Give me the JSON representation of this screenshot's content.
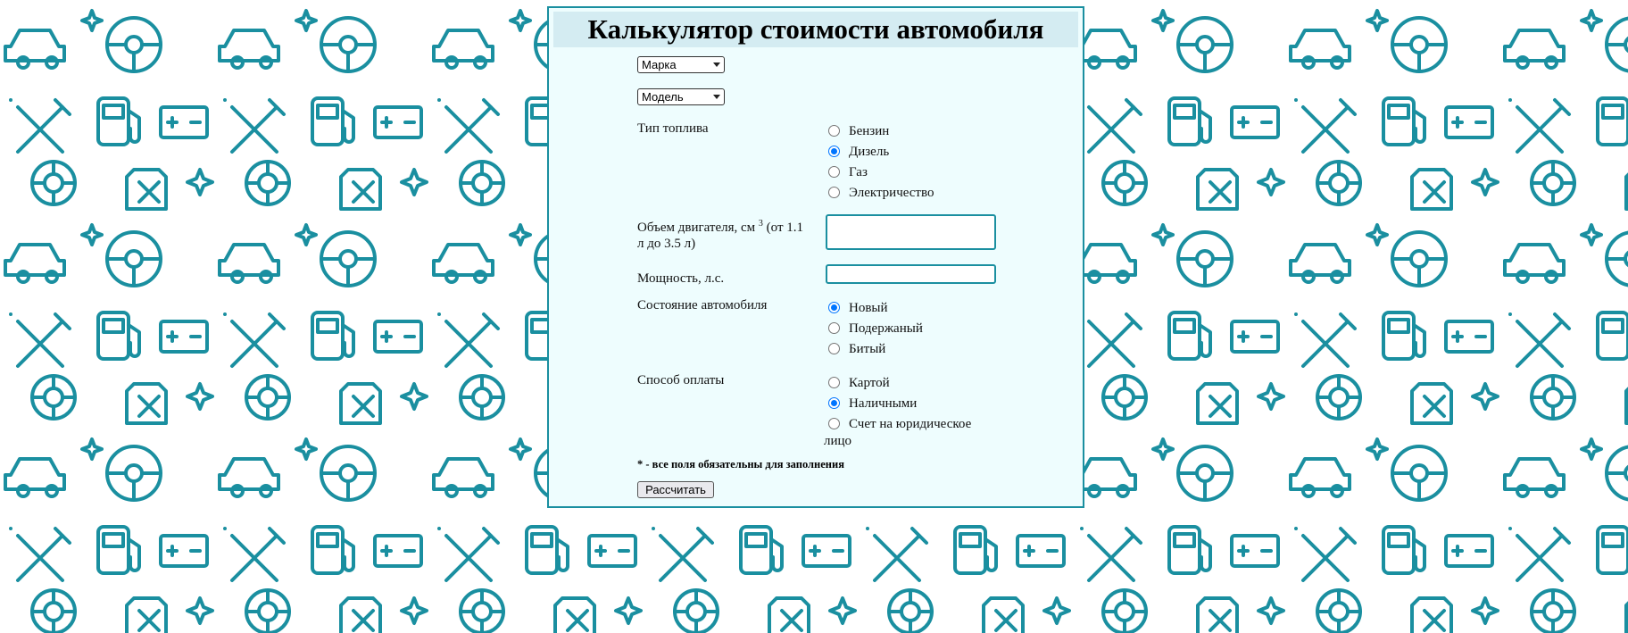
{
  "background": {
    "pattern_color": "#1a8fa0",
    "pattern": "automotive line icons"
  },
  "colors": {
    "accent": "#1a8fa0",
    "panel_bg": "#eefdfe",
    "title_bg": "#d4ecf2",
    "radio_checked": "#0075ff"
  },
  "title": "Калькулятор стоимости автомобиля",
  "brand_select": {
    "value": "Марка"
  },
  "model_select": {
    "value": "Модель"
  },
  "fuel": {
    "label": "Тип топлива",
    "options": [
      {
        "label": "Бензин",
        "checked": false
      },
      {
        "label": "Дизель",
        "checked": true
      },
      {
        "label": "Газ",
        "checked": false
      },
      {
        "label": "Электричество",
        "checked": false
      }
    ]
  },
  "engine_volume": {
    "label_main": "Объем двигателя, см",
    "label_sup": "3",
    "label_rest": " (от 1.1 л до 3.5 л)",
    "value": ""
  },
  "power": {
    "label": "Мощность, л.с.",
    "value": ""
  },
  "condition": {
    "label": "Состояние автомобиля",
    "options": [
      {
        "label": "Новый",
        "checked": true
      },
      {
        "label": "Подержаный",
        "checked": false
      },
      {
        "label": "Битый",
        "checked": false
      }
    ]
  },
  "payment": {
    "label": "Способ оплаты",
    "options": [
      {
        "label": "Картой",
        "checked": false
      },
      {
        "label": "Наличными",
        "checked": true
      },
      {
        "label": "Счет на юридическое",
        "checked": false
      }
    ],
    "wrap_text": "лицо"
  },
  "note": "* - все поля обязательны для заполнения",
  "submit_label": "Рассчитать"
}
